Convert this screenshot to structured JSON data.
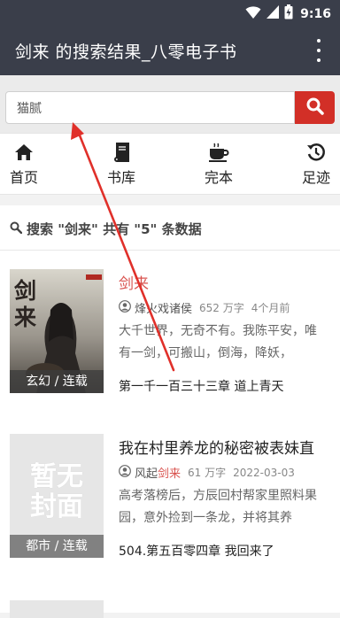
{
  "status_bar": {
    "time": "9:16"
  },
  "app_bar": {
    "title": "剑来 的搜索结果_八零电子书"
  },
  "search": {
    "value": "猫腻"
  },
  "nav": [
    {
      "label": "首页",
      "icon": "home-icon"
    },
    {
      "label": "书库",
      "icon": "book-icon"
    },
    {
      "label": "完本",
      "icon": "coffee-cup-icon"
    },
    {
      "label": "足迹",
      "icon": "history-icon"
    }
  ],
  "summary": {
    "text": "搜索 \"剑来\" 共有 \"5\" 条数据"
  },
  "books": [
    {
      "title": "剑来",
      "author": "烽火戏诸侯",
      "words": "652 万字",
      "updated": "4个月前",
      "description": "大千世界，无奇不有。我陈平安，唯有一剑，可搬山，倒海，降妖，",
      "latest": "第一千一百三十三章 道上青天",
      "tag": "玄幻 / 连载",
      "cover_text": "剑来"
    },
    {
      "title": "我在村里养龙的秘密被表妹直",
      "author_prefix": "风起",
      "author_highlight": "剑来",
      "words": "61 万字",
      "updated": "2022-03-03",
      "description": "高考落榜后，方辰回村帮家里照料果园，意外捡到一条龙，并将其养",
      "latest": "504.第五百零四章 我回来了",
      "tag": "都市 / 连载",
      "cover_text": "暂无封面"
    }
  ],
  "colors": {
    "header": "#3a3e4a",
    "accent": "#d22f27",
    "highlight": "#d9534f"
  }
}
